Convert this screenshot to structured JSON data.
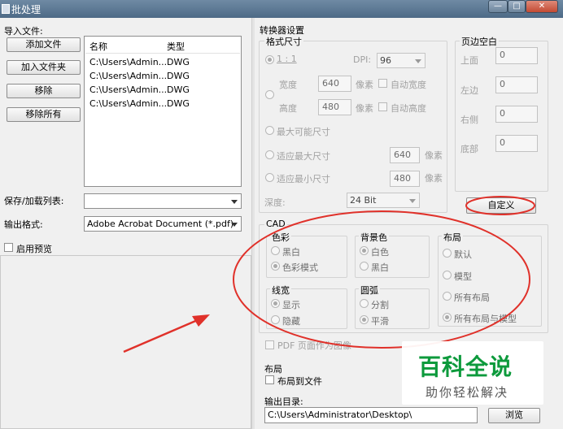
{
  "window": {
    "title": "批处理"
  },
  "left": {
    "import_label": "导入文件:",
    "buttons": {
      "add_file": "添加文件",
      "add_folder": "加入文件夹",
      "remove": "移除",
      "remove_all": "移除所有"
    },
    "list": {
      "headers": {
        "name": "名称",
        "type": "类型"
      },
      "rows": [
        {
          "name": "C:\\Users\\Admin...",
          "type": "DWG"
        },
        {
          "name": "C:\\Users\\Admin...",
          "type": "DWG"
        },
        {
          "name": "C:\\Users\\Admin...",
          "type": "DWG"
        },
        {
          "name": "C:\\Users\\Admin...",
          "type": "DWG"
        }
      ]
    },
    "save_load_label": "保存/加载列表:",
    "save_load_value": "",
    "output_format_label": "输出格式:",
    "output_format_value": "Adobe Acrobat Document (*.pdf)",
    "preview_label": "启用预览"
  },
  "converter": {
    "title": "转换器设置",
    "format_size": {
      "title": "格式尺寸",
      "one_to_one": "1 : 1",
      "dpi_label": "DPI:",
      "dpi_value": "96",
      "width_label": "宽度",
      "width_value": "640",
      "height_label": "高度",
      "height_value": "480",
      "px": "像素",
      "auto_width": "自动宽度",
      "auto_height": "自动高度",
      "max_possible": "最大可能尺寸",
      "fit_max": "适应最大尺寸",
      "fit_max_value": "640",
      "fit_min": "适应最小尺寸",
      "fit_min_value": "480",
      "depth_label": "深度:",
      "depth_value": "24 Bit"
    },
    "margins": {
      "title": "页边空白",
      "top_label": "上面",
      "top_value": "0",
      "left_label": "左边",
      "left_value": "0",
      "right_label": "右侧",
      "right_value": "0",
      "bottom_label": "底部",
      "bottom_value": "0",
      "custom_button": "自定义"
    },
    "cad": {
      "title": "CAD",
      "color": {
        "title": "色彩",
        "opt1": "黑白",
        "opt2": "色彩模式"
      },
      "background": {
        "title": "背景色",
        "opt1": "白色",
        "opt2": "黑白"
      },
      "layout": {
        "title": "布局",
        "opt1": "默认",
        "opt2": "模型",
        "opt3": "所有布局",
        "opt4": "所有布局与模型"
      },
      "linewidth": {
        "title": "线宽",
        "opt1": "显示",
        "opt2": "隐藏"
      },
      "arc": {
        "title": "圆弧",
        "opt1": "分割",
        "opt2": "平滑"
      }
    },
    "pdf_as_image": "PDF 页面作为图像",
    "layout_section": {
      "title": "布局",
      "layout_to_file": "布局到文件"
    },
    "output_dir": {
      "label": "输出目录:",
      "value": "C:\\Users\\Administrator\\Desktop\\",
      "browse": "浏览"
    }
  },
  "watermark": {
    "title": "百科全说",
    "subtitle": "助你轻松解决"
  },
  "colors": {
    "accent_red": "#e0312a",
    "watermark_green": "#0d9a3c"
  }
}
